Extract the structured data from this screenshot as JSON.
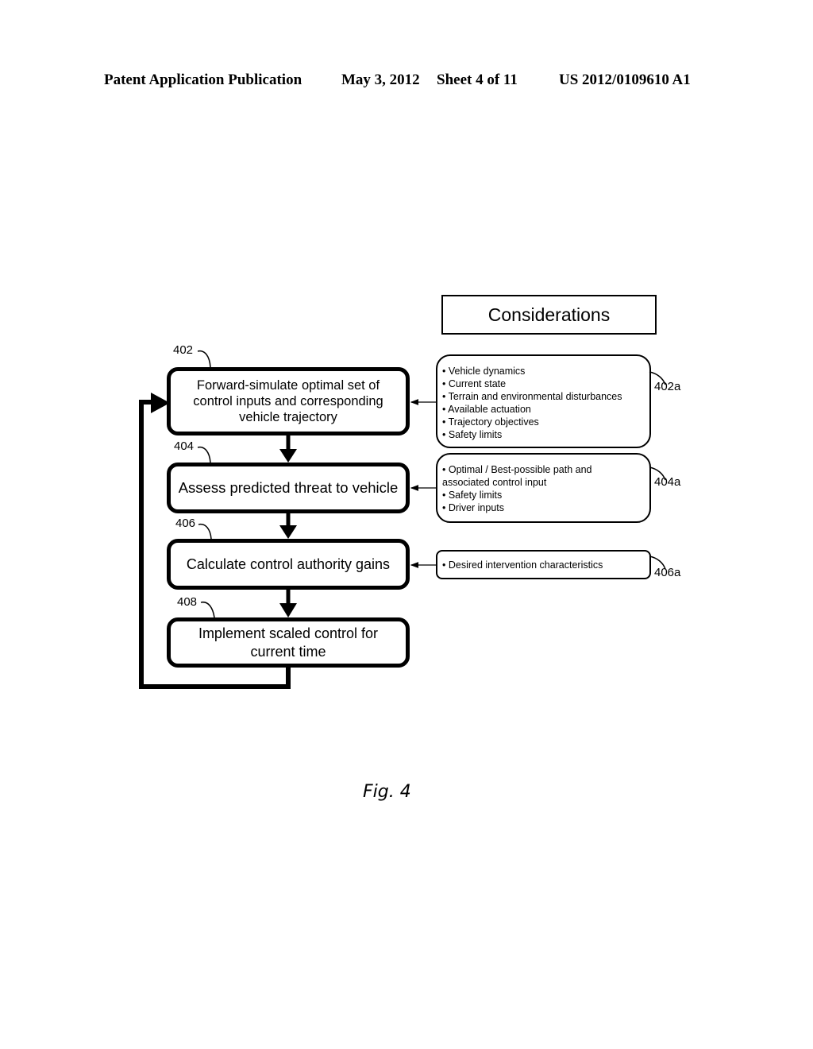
{
  "header": {
    "publication": "Patent Application Publication",
    "date": "May 3, 2012",
    "sheet": "Sheet 4 of 11",
    "number": "US 2012/0109610 A1"
  },
  "considerations_title": "Considerations",
  "steps": [
    {
      "ref": "402",
      "text": "Forward-simulate optimal set of control inputs and corresponding vehicle trajectory"
    },
    {
      "ref": "404",
      "text": "Assess predicted threat to vehicle"
    },
    {
      "ref": "406",
      "text": "Calculate control authority gains"
    },
    {
      "ref": "408",
      "text": "Implement scaled control for current time"
    }
  ],
  "considerations": [
    {
      "ref": "402a",
      "items": [
        "• Vehicle dynamics",
        "• Current state",
        "• Terrain and environmental disturbances",
        "• Available actuation",
        "• Trajectory objectives",
        "• Safety limits"
      ]
    },
    {
      "ref": "404a",
      "items": [
        "• Optimal / Best-possible path and",
        "associated control input",
        "• Safety limits",
        "• Driver inputs"
      ]
    },
    {
      "ref": "406a",
      "items": [
        "• Desired intervention characteristics"
      ]
    }
  ],
  "figure_label": "Fig. 4"
}
